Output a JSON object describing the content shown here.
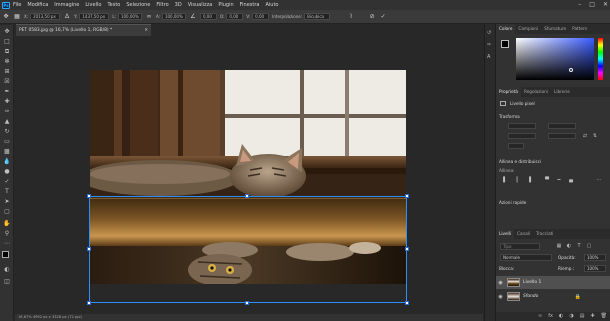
{
  "menubar": {
    "logo": "Ps",
    "items": [
      "File",
      "Modifica",
      "Immagine",
      "Livello",
      "Testo",
      "Selezione",
      "Filtro",
      "3D",
      "Visualizza",
      "Plugin",
      "Finestra",
      "Aiuto"
    ]
  },
  "options": {
    "x_label": "X:",
    "x_value": "2013,50 px",
    "y_label": "Y:",
    "y_value": "1437,50 px",
    "w_label": "L:",
    "w_value": "100,00%",
    "h_label": "A:",
    "h_value": "100,00%",
    "angle_value": "0,00",
    "h_skew_label": "O:",
    "h_skew_value": "0,00",
    "v_skew_label": "V:",
    "v_skew_value": "0,00",
    "interp_label": "Interpolazione:",
    "interp_value": "Bicubica",
    "cancel_icon": "cancel-icon",
    "commit_icon": "commit-icon"
  },
  "document": {
    "tab_title": "PET 0583.jpg @ 16,7% (Livello 1, RGB/8) *",
    "status": "16,67%   4992 px x 3328 px (72 ppi)"
  },
  "panels": {
    "top_tabs": [
      "Colore",
      "Campioni",
      "Sfumature",
      "Pattern"
    ],
    "mid_tabs": [
      "Proprietà",
      "Regolazioni",
      "Librerie"
    ],
    "pixel_layer_label": "Livello pixel",
    "transform_title": "Trasforma",
    "align_title": "Allinea e distribuisci",
    "align_sub": "Allinea:",
    "quick_actions_title": "Azioni rapide",
    "layers_tabs": [
      "Livelli",
      "Canali",
      "Tracciati"
    ],
    "search_placeholder": "Tipo",
    "blend_mode": "Normale",
    "opacity_label": "Opacità:",
    "opacity_value": "100%",
    "lock_label": "Blocca:",
    "fill_label": "Riemp.:",
    "fill_value": "100%",
    "layers": [
      {
        "name": "Livello 1"
      },
      {
        "name": "Sfondo"
      }
    ],
    "colors": {
      "accent": "#31a8ff",
      "selection": "#2a8fff"
    }
  }
}
